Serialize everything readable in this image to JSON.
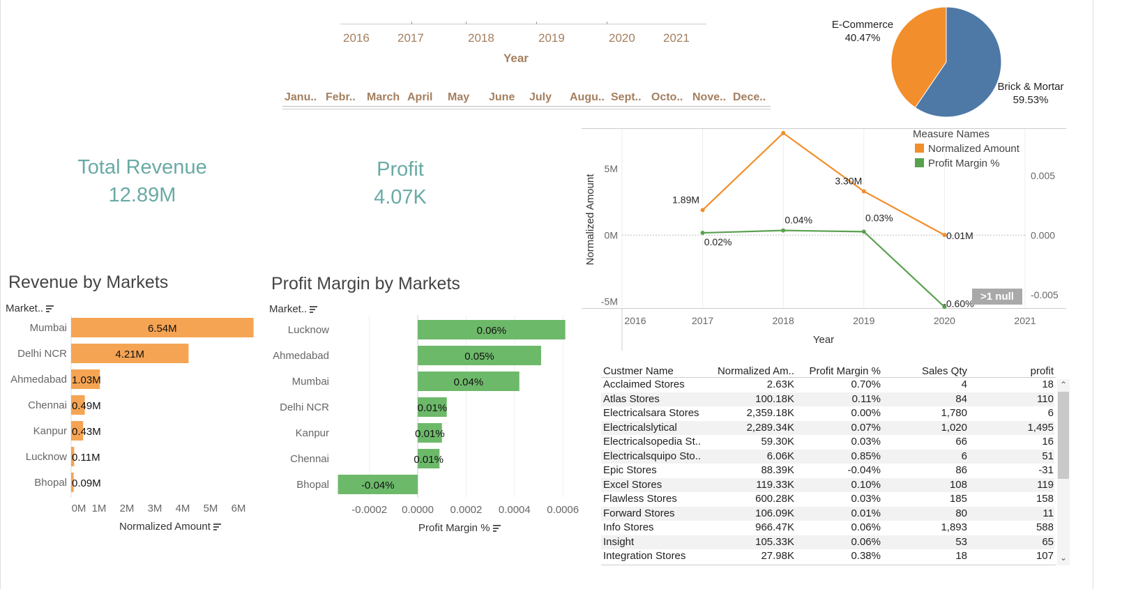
{
  "filters": {
    "year_header": "Year",
    "years": [
      "2016",
      "2017",
      "2018",
      "2019",
      "2020",
      "2021"
    ],
    "months": [
      "Janu..",
      "Febr..",
      "March",
      "April",
      "May",
      "June",
      "July",
      "Augu..",
      "Sept..",
      "Octo..",
      "Nove..",
      "Dece.."
    ]
  },
  "kpis": {
    "revenue_title": "Total Revenue",
    "revenue_value": "12.89M",
    "profit_title": "Profit",
    "profit_value": "4.07K"
  },
  "colors": {
    "orange": "#f5a453",
    "orange_line": "#f28e2b",
    "green": "#6db96a",
    "green_line": "#59a14f",
    "blue": "#4e79a7",
    "kpi": "#6aaaa5",
    "filter_text": "#a47f5f"
  },
  "pie": {
    "chart_data": {
      "type": "pie",
      "slices": [
        {
          "label": "Brick & Mortar",
          "pct_label": "59.53%",
          "value": 59.53
        },
        {
          "label": "E-Commerce",
          "pct_label": "40.47%",
          "value": 40.47
        }
      ]
    }
  },
  "revenue_markets": {
    "title": "Revenue by Markets",
    "dim_header": "Market..",
    "xlabel": "Normalized Amount",
    "ticks": [
      "0M",
      "1M",
      "2M",
      "3M",
      "4M",
      "5M",
      "6M"
    ],
    "chart_data": {
      "type": "bar",
      "categories": [
        "Mumbai",
        "Delhi NCR",
        "Ahmedabad",
        "Chennai",
        "Kanpur",
        "Lucknow",
        "Bhopal"
      ],
      "values": [
        6.54,
        4.21,
        1.03,
        0.49,
        0.43,
        0.11,
        0.09
      ],
      "labels": [
        "6.54M",
        "4.21M",
        "1.03M",
        "0.49M",
        "0.43M",
        "0.11M",
        "0.09M"
      ],
      "xlim": [
        0,
        6.55
      ],
      "units": "M"
    }
  },
  "profit_markets": {
    "title": "Profit Margin by Markets",
    "dim_header": "Market..",
    "xlabel": "Profit Margin %",
    "ticks": [
      "-0.0002",
      "0.0000",
      "0.0002",
      "0.0004",
      "0.0006"
    ],
    "chart_data": {
      "type": "bar",
      "categories": [
        "Lucknow",
        "Ahmedabad",
        "Mumbai",
        "Delhi NCR",
        "Kanpur",
        "Chennai",
        "Bhopal"
      ],
      "values": [
        0.00061,
        0.00051,
        0.00042,
        0.00012,
        0.0001,
        9e-05,
        -0.00033
      ],
      "labels": [
        "0.06%",
        "0.05%",
        "0.04%",
        "0.01%",
        "0.01%",
        "0.01%",
        "-0.04%"
      ],
      "xlim": [
        -0.0003,
        0.00066
      ]
    }
  },
  "trend": {
    "ylabel": "Normalized Amount",
    "xlabel": "Year",
    "legend_title": "Measure Names",
    "null_badge": ">1 null",
    "left_ticks": [
      "5M",
      "0M",
      "-5M"
    ],
    "right_ticks": [
      "0.005",
      "0.000",
      "-0.005"
    ],
    "x_ticks": [
      "2016",
      "2017",
      "2018",
      "2019",
      "2020",
      "2021"
    ],
    "chart_data": {
      "type": "line",
      "x": [
        2017,
        2018,
        2019,
        2020
      ],
      "xlim": [
        2016,
        2021
      ],
      "series": [
        {
          "name": "Normalized Amount",
          "axis": "left",
          "values": [
            1.89,
            7.69,
            3.3,
            0.01
          ],
          "labels": [
            "1.89M",
            "7.69M",
            "3.30M",
            "0.01M"
          ],
          "ylim": [
            -5.5,
            8
          ]
        },
        {
          "name": "Profit Margin %",
          "axis": "right",
          "values": [
            0.0002,
            0.0004,
            0.0003,
            -0.006
          ],
          "labels": [
            "0.02%",
            "0.04%",
            "0.03%",
            "-0.60%"
          ],
          "ylim": [
            -0.0061,
            0.0089
          ]
        }
      ]
    }
  },
  "table": {
    "headers": [
      "Custmer Name",
      "Normalized Am..",
      "Profit Margin %",
      "Sales Qty",
      "profit"
    ],
    "rows": [
      [
        "Acclaimed Stores",
        "2.63K",
        "0.70%",
        "4",
        "18"
      ],
      [
        "Atlas Stores",
        "100.18K",
        "0.11%",
        "84",
        "110"
      ],
      [
        "Electricalsara Stores",
        "2,359.18K",
        "0.00%",
        "1,780",
        "6"
      ],
      [
        "Electricalslytical",
        "2,289.34K",
        "0.07%",
        "1,020",
        "1,495"
      ],
      [
        "Electricalsopedia St..",
        "59.30K",
        "0.03%",
        "66",
        "16"
      ],
      [
        "Electricalsquipo Sto..",
        "6.06K",
        "0.85%",
        "6",
        "51"
      ],
      [
        "Epic Stores",
        "88.39K",
        "-0.04%",
        "86",
        "-31"
      ],
      [
        "Excel Stores",
        "119.33K",
        "0.10%",
        "108",
        "119"
      ],
      [
        "Flawless Stores",
        "600.28K",
        "0.03%",
        "185",
        "158"
      ],
      [
        "Forward Stores",
        "106.09K",
        "0.01%",
        "80",
        "11"
      ],
      [
        "Info Stores",
        "966.47K",
        "0.06%",
        "1,893",
        "588"
      ],
      [
        "Insight",
        "105.33K",
        "0.06%",
        "53",
        "65"
      ],
      [
        "Integration Stores",
        "27.98K",
        "0.38%",
        "18",
        "107"
      ]
    ]
  }
}
